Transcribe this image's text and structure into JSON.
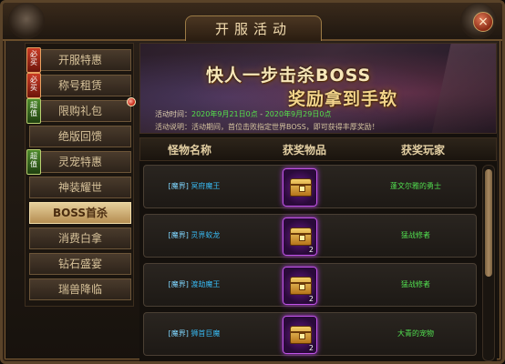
{
  "window": {
    "title": "开服活动",
    "close_label": "×"
  },
  "sidebar": {
    "items": [
      {
        "label": "开服特惠",
        "badge": "必买",
        "badge_color": "red",
        "active": false
      },
      {
        "label": "称号租赁",
        "badge": "必买",
        "badge_color": "red",
        "active": false
      },
      {
        "label": "限购礼包",
        "badge": "超值",
        "badge_color": "green",
        "active": false,
        "dot": true
      },
      {
        "label": "绝版回馈",
        "badge": "",
        "active": false
      },
      {
        "label": "灵宠特惠",
        "badge": "超值",
        "badge_color": "green",
        "active": false
      },
      {
        "label": "神装耀世",
        "badge": "",
        "active": false
      },
      {
        "label": "BOSS首杀",
        "badge": "",
        "active": true
      },
      {
        "label": "消费白拿",
        "badge": "",
        "active": false
      },
      {
        "label": "钻石盛宴",
        "badge": "",
        "active": false
      },
      {
        "label": "瑞兽降临",
        "badge": "",
        "active": false
      }
    ]
  },
  "banner": {
    "title_line1": "快人一步击杀BOSS",
    "title_line2": "奖励拿到手软",
    "time_label": "活动时间：",
    "time_start": "2020年9月21日0点",
    "time_sep": " - ",
    "time_end": "2020年9月29日0点",
    "desc": "活动说明：活动期间，首位击败指定世界BOSS，即可获得丰厚奖励！"
  },
  "table": {
    "headers": {
      "monster": "怪物名称",
      "reward": "获奖物品",
      "player": "获奖玩家"
    },
    "rows": [
      {
        "tag": "[魔界]",
        "monster": "冥府魔王",
        "qty": "",
        "player": "蓬文尔雅的勇士"
      },
      {
        "tag": "[魔界]",
        "monster": "灵界蛟龙",
        "qty": "2",
        "player": "猛战修者"
      },
      {
        "tag": "[魔界]",
        "monster": "渡劫魔王",
        "qty": "2",
        "player": "猛战修者"
      },
      {
        "tag": "[魔界]",
        "monster": "狮首巨魔",
        "qty": "2",
        "player": "大青的宠物"
      }
    ]
  },
  "colors": {
    "accent": "#f3d48a",
    "player_green": "#52e050",
    "monster_blue": "#38b8f0",
    "reward_glow": "#c154e8"
  },
  "icons": {
    "close": "close-icon",
    "chest": "treasure-chest-icon",
    "dragon": "dragon-ornament-icon"
  }
}
